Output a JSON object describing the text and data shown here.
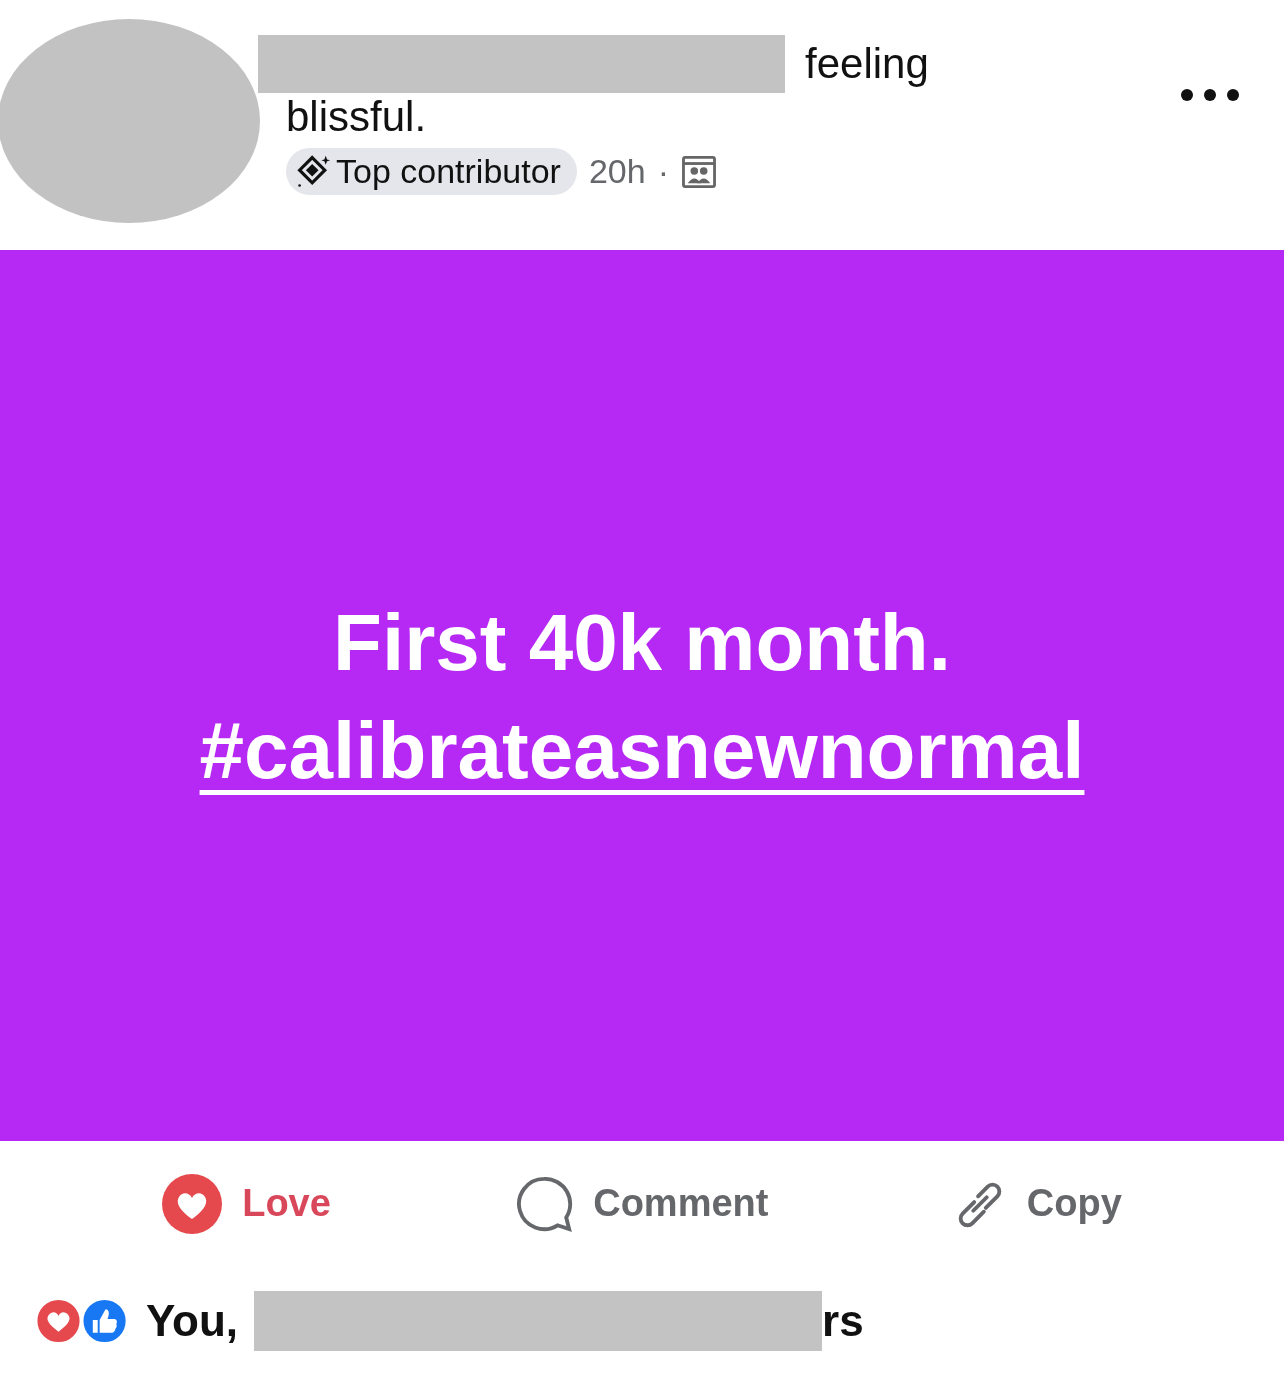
{
  "post": {
    "feeling_text": "feeling",
    "feeling_value": "blissful.",
    "badge": "Top contributor",
    "time": "20h",
    "separator": "·",
    "text_lines": [
      {
        "text": "First 40k month.",
        "kind": "plain"
      },
      {
        "text": "#calibrateasnewnormal",
        "kind": "hashtag"
      }
    ]
  },
  "actions": [
    {
      "label": "Love",
      "kind": "love",
      "selected": true
    },
    {
      "label": "Comment",
      "kind": "comment",
      "selected": false
    },
    {
      "label": "Copy",
      "kind": "copy",
      "selected": false
    }
  ],
  "reactions": {
    "lead": "You,",
    "tail": "rs"
  }
}
